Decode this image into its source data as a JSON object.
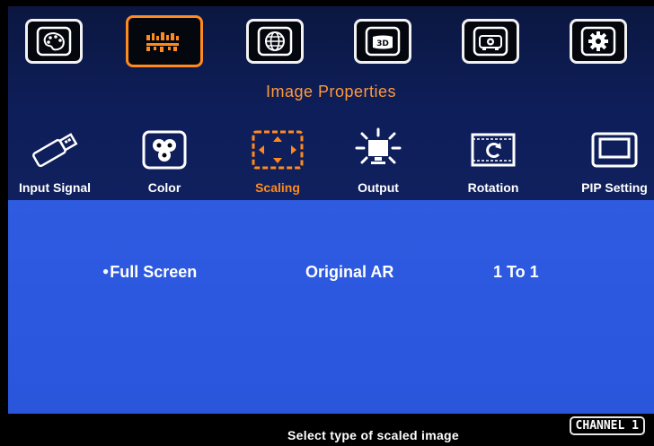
{
  "top_menu": {
    "tabs": [
      {
        "icon": "palette-icon"
      },
      {
        "icon": "image-properties-icon"
      },
      {
        "icon": "globe-icon"
      },
      {
        "icon": "3d-icon"
      },
      {
        "icon": "projector-icon"
      },
      {
        "icon": "gear-icon"
      }
    ],
    "active_index": 1
  },
  "section_title": "Image Properties",
  "sub_menu": {
    "items": [
      {
        "label": "Input Signal",
        "icon": "usb-icon"
      },
      {
        "label": "Color",
        "icon": "color-icon"
      },
      {
        "label": "Scaling",
        "icon": "scaling-icon"
      },
      {
        "label": "Output",
        "icon": "output-icon"
      },
      {
        "label": "Rotation",
        "icon": "rotation-icon"
      },
      {
        "label": "PIP Setting",
        "icon": "pip-icon"
      }
    ],
    "active_index": 2
  },
  "scaling_options": {
    "bullet": "●",
    "items": [
      "Full Screen",
      "Original AR",
      "1 To 1"
    ],
    "selected_index": 0
  },
  "status_bar": {
    "hint": "Select type of scaled image",
    "channel": "CHANNEL 1"
  },
  "colors": {
    "accent": "#ff8a1e",
    "header_bg": "#0e1e5a",
    "main_bg": "#2b58df",
    "text": "#ffffff"
  }
}
